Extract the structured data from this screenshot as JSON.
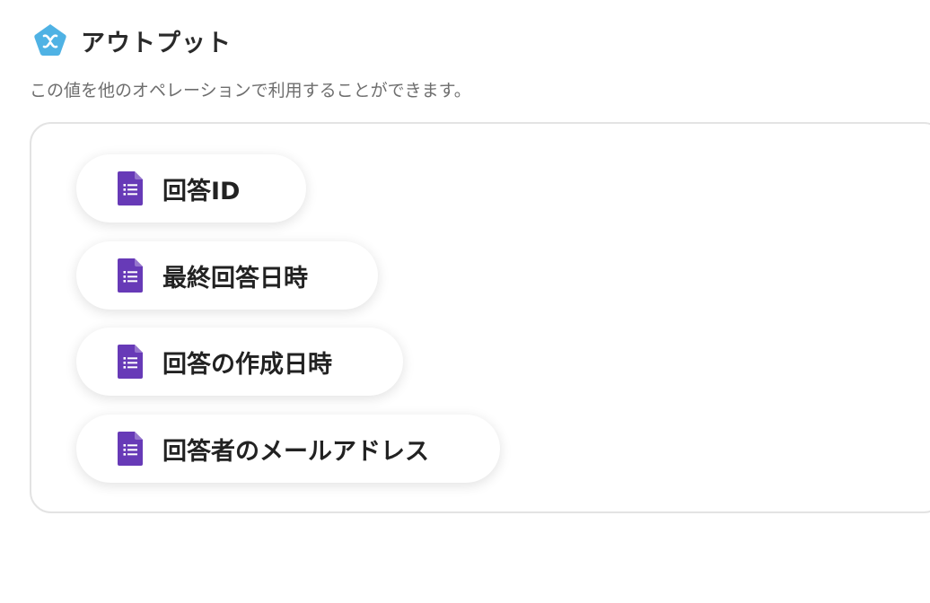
{
  "header": {
    "title": "アウトプット",
    "logo_icon": "yoom-pentagon-logo",
    "logo_color": "#4fb2e4"
  },
  "description": "この値を他のオペレーションで利用することができます。",
  "outputs": [
    {
      "label": "回答ID",
      "icon": "google-forms-icon"
    },
    {
      "label": "最終回答日時",
      "icon": "google-forms-icon"
    },
    {
      "label": "回答の作成日時",
      "icon": "google-forms-icon"
    },
    {
      "label": "回答者のメールアドレス",
      "icon": "google-forms-icon"
    }
  ],
  "colors": {
    "forms_purple": "#673ab7",
    "title_text": "#2a2a2a",
    "description_text": "#6e6e6e",
    "panel_border": "#e3e3e3"
  }
}
